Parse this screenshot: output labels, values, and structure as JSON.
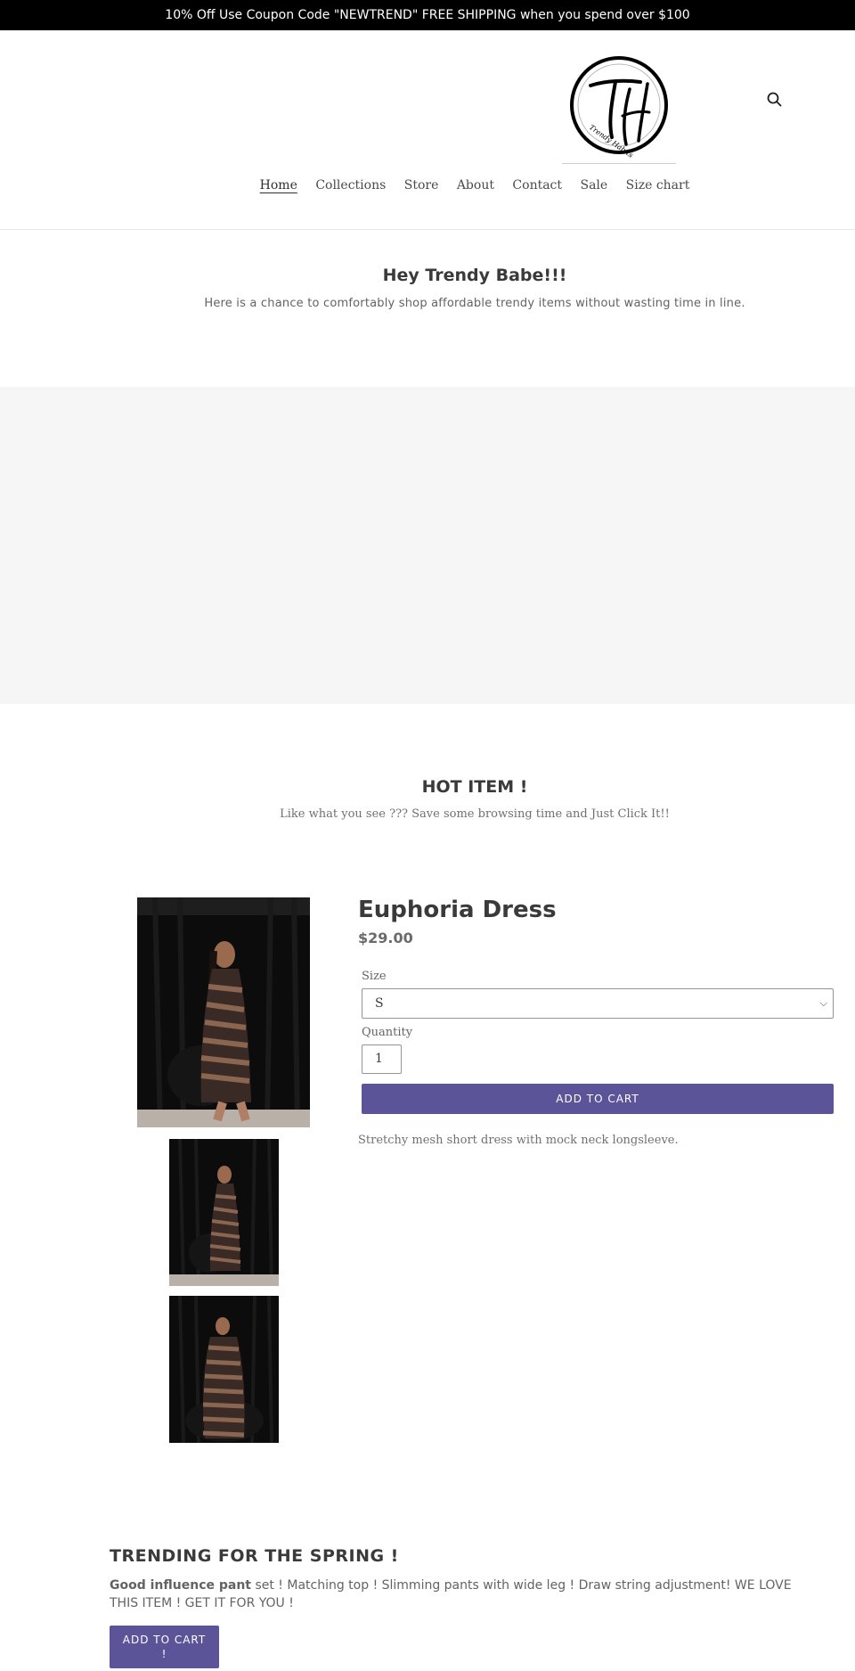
{
  "announcement": "10% Off Use Coupon Code \"NEWTREND\" FREE SHIPPING when you spend over $100",
  "logo": {
    "initials": "TH",
    "brand": "Trendy Habits"
  },
  "nav": [
    "Home",
    "Collections",
    "Store",
    "About",
    "Contact",
    "Sale",
    "Size chart"
  ],
  "intro": {
    "title": "Hey Trendy Babe!!!",
    "subtitle": "Here is a chance to comfortably  shop affordable trendy items without wasting time in line."
  },
  "hot": {
    "title": "HOT ITEM !",
    "subtitle": "Like what you see ???  Save some browsing time and Just Click It!!"
  },
  "product": {
    "title": "Euphoria Dress",
    "price": "$29.00",
    "size_label": "Size",
    "size_value": "S",
    "quantity_label": "Quantity",
    "quantity_value": "1",
    "add_to_cart": "ADD TO CART",
    "description": "Stretchy mesh short dress with mock neck longsleeve."
  },
  "trending": {
    "title": "TRENDING FOR THE SPRING !",
    "bold_text": "Good influence pant",
    "text": " set ! Matching top ! Slimming pants with wide leg ! Draw string adjustment! WE LOVE THIS ITEM ! GET IT FOR YOU !",
    "button_line1": "ADD TO CART",
    "button_line2": "!"
  },
  "colors": {
    "accent": "#5c5498",
    "announcement_bg": "#000000",
    "hero_bg": "#f6f6f6"
  },
  "icons": {
    "search": "search-icon"
  }
}
